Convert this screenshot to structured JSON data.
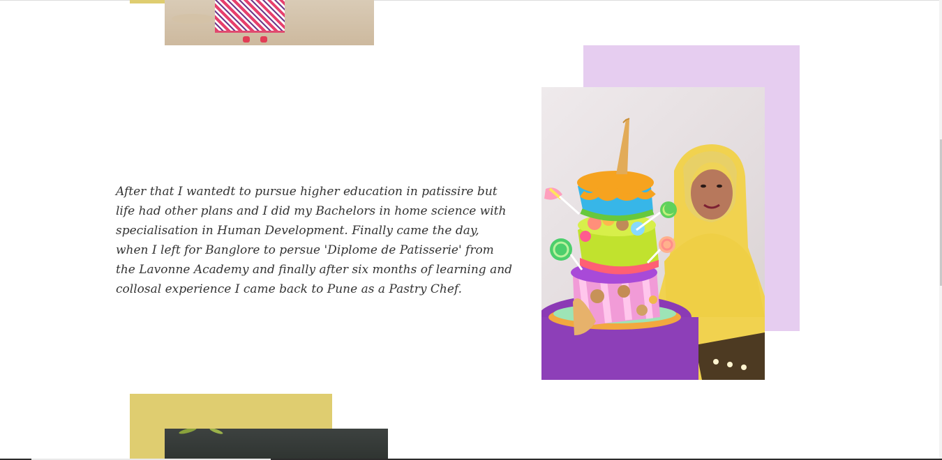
{
  "story": {
    "paragraph": "After that I wantedt to pursue higher education in patissire but life had other plans and I did my Bachelors in home science with specialisation in Human Development. Finally came the day, when I left for Banglore to persue 'Diplome de Patisserie' from the Lavonne Academy and finally after six months of learning and collosal experience I came back to Pune as a Pastry Chef."
  },
  "colors": {
    "accent_yellow": "#dfcd70",
    "accent_lavender": "#e6cdf0",
    "text": "#333333"
  }
}
